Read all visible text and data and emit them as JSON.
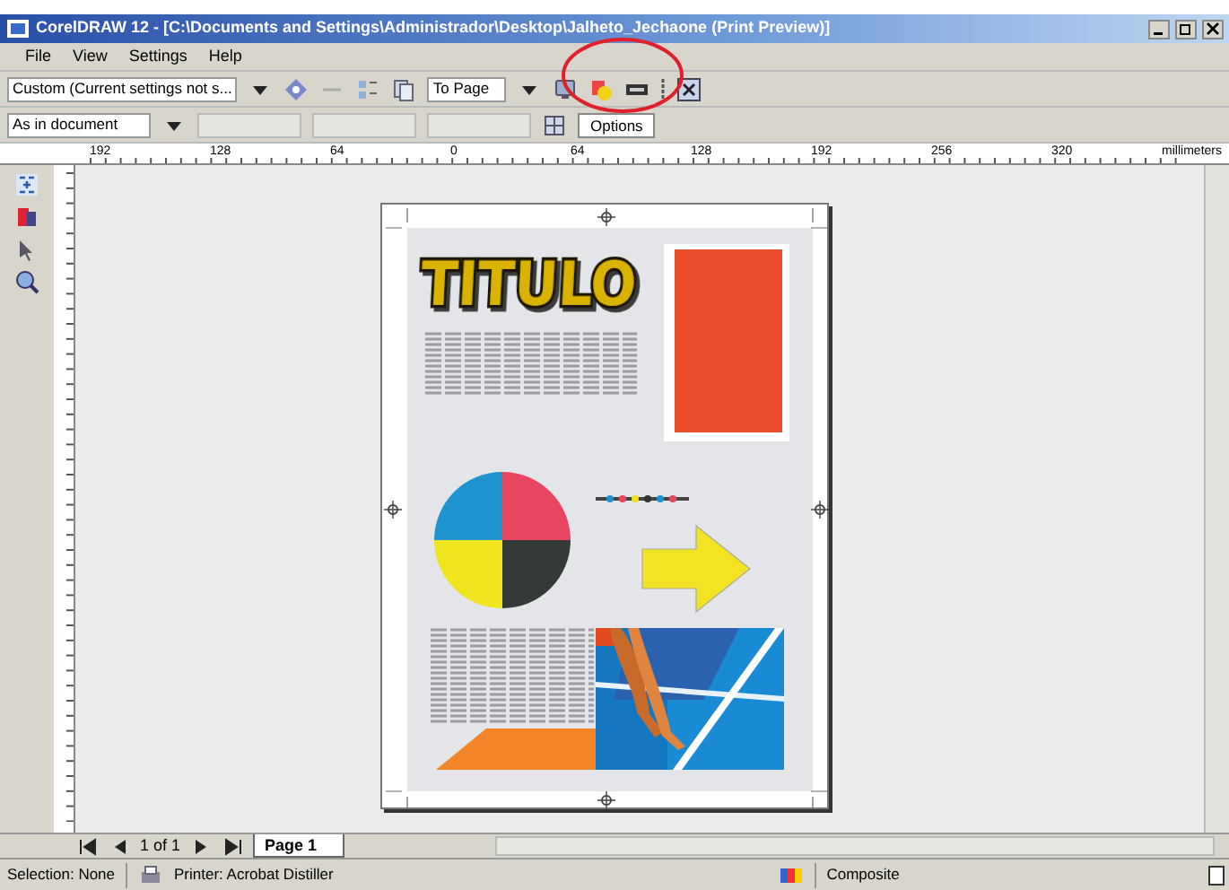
{
  "window": {
    "title": "CorelDRAW 12 - [C:\\Documents and Settings\\Administrador\\Desktop\\Jalheto_Jechaone (Print Preview)]"
  },
  "menu": [
    "File",
    "View",
    "Settings",
    "Help"
  ],
  "toolbar_1": {
    "preset_dropdown": "Custom (Current settings not s...",
    "zoom_dropdown": "To Page"
  },
  "toolbar_2": {
    "source_dropdown": "As in document",
    "position_fields": [
      {
        "disabled": true
      },
      {
        "disabled": true
      },
      {
        "disabled": true
      }
    ],
    "options_button": "Options"
  },
  "annotation": {
    "kind": "circle",
    "color": "#e0202a"
  },
  "ruler": {
    "labels": [
      "192",
      "128",
      "64",
      "0",
      "64",
      "128",
      "192",
      "256",
      "320"
    ],
    "unit": "millimeters"
  },
  "page": {
    "heading": "TITULO"
  },
  "page_nav": {
    "counter": "1 of 1",
    "tabs": [
      {
        "label": "Page 1",
        "selected": true
      }
    ]
  },
  "status_bar": {
    "selection": "Selection: None",
    "printer": "Printer: Acrobat Distiller",
    "mode": "Composite"
  }
}
